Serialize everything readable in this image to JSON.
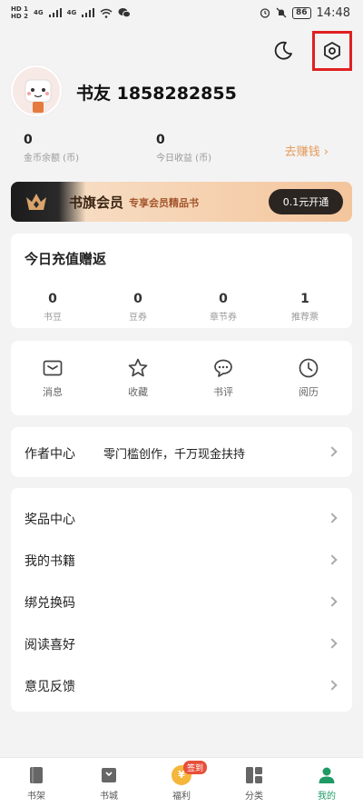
{
  "status_bar": {
    "sim_labels": [
      "HD 1",
      "HD 2"
    ],
    "network_labels": [
      "4G",
      "4G"
    ],
    "battery": "86",
    "time": "14:48"
  },
  "profile": {
    "username": "书友 1858282855"
  },
  "stats": {
    "coin_balance": {
      "value": "0",
      "label": "金币余额 (币)"
    },
    "today_income": {
      "value": "0",
      "label": "今日收益 (币)"
    },
    "earn_link": "去赚钱 ›"
  },
  "vip": {
    "title": "书旗会员",
    "subtitle": "专享会员精品书",
    "button": "0.1元开通"
  },
  "recharge": {
    "title": "今日充值赠返",
    "items": [
      {
        "value": "0",
        "label": "书豆"
      },
      {
        "value": "0",
        "label": "豆券"
      },
      {
        "value": "0",
        "label": "章节券"
      },
      {
        "value": "1",
        "label": "推荐票"
      }
    ]
  },
  "tools": [
    {
      "label": "消息",
      "icon": "message-icon"
    },
    {
      "label": "收藏",
      "icon": "star-icon"
    },
    {
      "label": "书评",
      "icon": "comment-icon"
    },
    {
      "label": "阅历",
      "icon": "clock-icon"
    }
  ],
  "author": {
    "title": "作者中心",
    "desc": "零门槛创作，千万现金扶持"
  },
  "menu": [
    {
      "label": "奖品中心"
    },
    {
      "label": "我的书籍"
    },
    {
      "label": "绑兑换码"
    },
    {
      "label": "阅读喜好"
    },
    {
      "label": "意见反馈"
    }
  ],
  "tabbar": {
    "tabs": [
      {
        "label": "书架"
      },
      {
        "label": "书城"
      },
      {
        "label": "福利",
        "badge": "签到",
        "coin": "¥"
      },
      {
        "label": "分类"
      },
      {
        "label": "我的"
      }
    ],
    "active_color": "#1e9a64"
  },
  "colors": {
    "accent_orange": "#e59a58",
    "highlight_box": "#e02020"
  }
}
